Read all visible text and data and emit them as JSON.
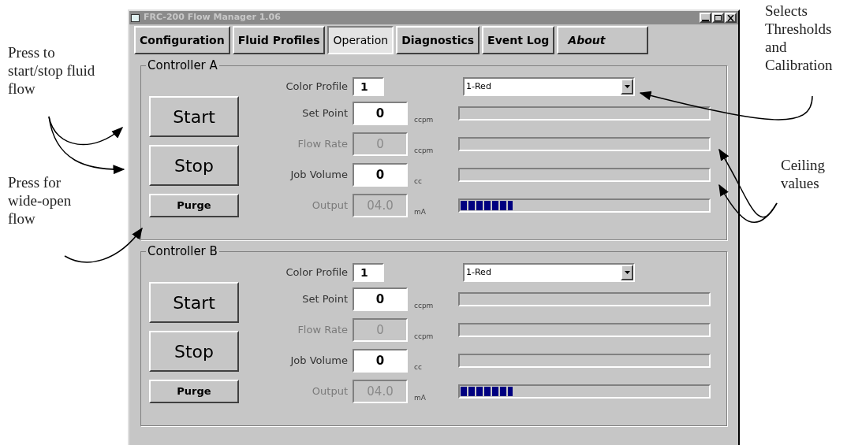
{
  "window": {
    "title": "FRC-200 Flow Manager 1.06"
  },
  "tabs": [
    {
      "label": "Configuration",
      "selected": false
    },
    {
      "label": "Fluid Profiles",
      "selected": false
    },
    {
      "label": "Operation",
      "selected": true
    },
    {
      "label": "Diagnostics",
      "selected": false
    },
    {
      "label": "Event Log",
      "selected": false
    },
    {
      "label": "About",
      "selected": false
    }
  ],
  "controllers": [
    {
      "title": "Controller A",
      "buttons": [
        {
          "label": "Start",
          "kind": "large"
        },
        {
          "label": "Stop",
          "kind": "large"
        },
        {
          "label": "Purge",
          "kind": "small"
        }
      ],
      "color_profile": {
        "label": "Color Profile",
        "value": "1",
        "selection": "1-Red"
      },
      "rows": [
        {
          "label": "Set Point",
          "value": "0",
          "unit": "ccpm",
          "disabled": false,
          "level": 0
        },
        {
          "label": "Flow Rate",
          "value": "0",
          "unit": "ccpm",
          "disabled": true,
          "level": 0
        },
        {
          "label": "Job Volume",
          "value": "0",
          "unit": "cc",
          "disabled": false,
          "level": 0
        },
        {
          "label": "Output",
          "value": "04.0",
          "unit": "mA",
          "disabled": true,
          "level": 0.21
        }
      ]
    },
    {
      "title": "Controller B",
      "buttons": [
        {
          "label": "Start",
          "kind": "large"
        },
        {
          "label": "Stop",
          "kind": "large"
        },
        {
          "label": "Purge",
          "kind": "small"
        }
      ],
      "color_profile": {
        "label": "Color Profile",
        "value": "1",
        "selection": "1-Red"
      },
      "rows": [
        {
          "label": "Set Point",
          "value": "0",
          "unit": "ccpm",
          "disabled": false,
          "level": 0
        },
        {
          "label": "Flow Rate",
          "value": "0",
          "unit": "ccpm",
          "disabled": true,
          "level": 0
        },
        {
          "label": "Job Volume",
          "value": "0",
          "unit": "cc",
          "disabled": false,
          "level": 0
        },
        {
          "label": "Output",
          "value": "04.0",
          "unit": "mA",
          "disabled": true,
          "level": 0.21
        }
      ]
    }
  ],
  "left_annotations": [
    {
      "text": "Press to start/stop fluid flow"
    },
    {
      "text": "Press for wide-open flow"
    }
  ],
  "right_annotations": [
    {
      "text": "Selects Thresholds and Calibration"
    },
    {
      "text": "Ceiling values"
    }
  ]
}
